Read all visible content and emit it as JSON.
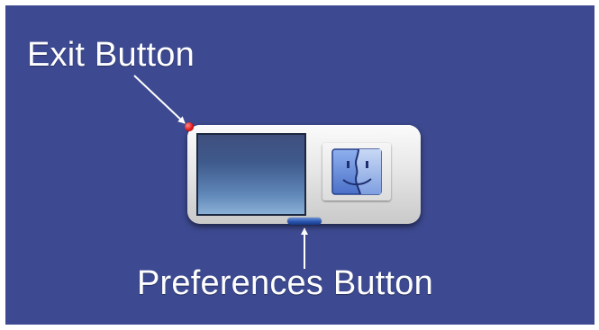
{
  "callouts": {
    "exit": "Exit Button",
    "preferences": "Preferences Button"
  },
  "widget": {
    "icon": "finder-icon",
    "exit_color": "#e01010",
    "preferences_color": "#2a54b0"
  },
  "colors": {
    "background": "#3d4a91",
    "label": "#ffffff"
  }
}
